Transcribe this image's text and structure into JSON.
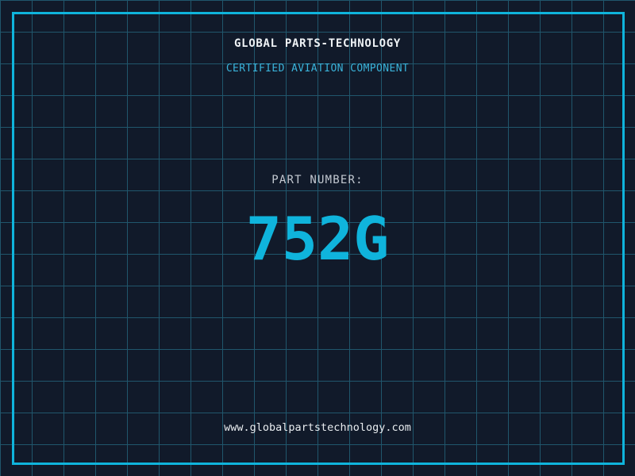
{
  "header": {
    "title": "GLOBAL PARTS-TECHNOLOGY",
    "subtitle": "CERTIFIED AVIATION COMPONENT"
  },
  "part": {
    "label": "PART NUMBER:",
    "number": "752G"
  },
  "footer": {
    "website": "www.globalpartstechnology.com"
  },
  "colors": {
    "background": "#111a2a",
    "grid_line": "#20566c",
    "frame_cyan": "#0fb4dc",
    "part_number_cyan": "#0fb4dc",
    "subtitle_cyan": "#3ab3da",
    "title_white": "#eef2f5",
    "label_gray": "#c3c9d1",
    "url_white": "#e8ecef"
  }
}
